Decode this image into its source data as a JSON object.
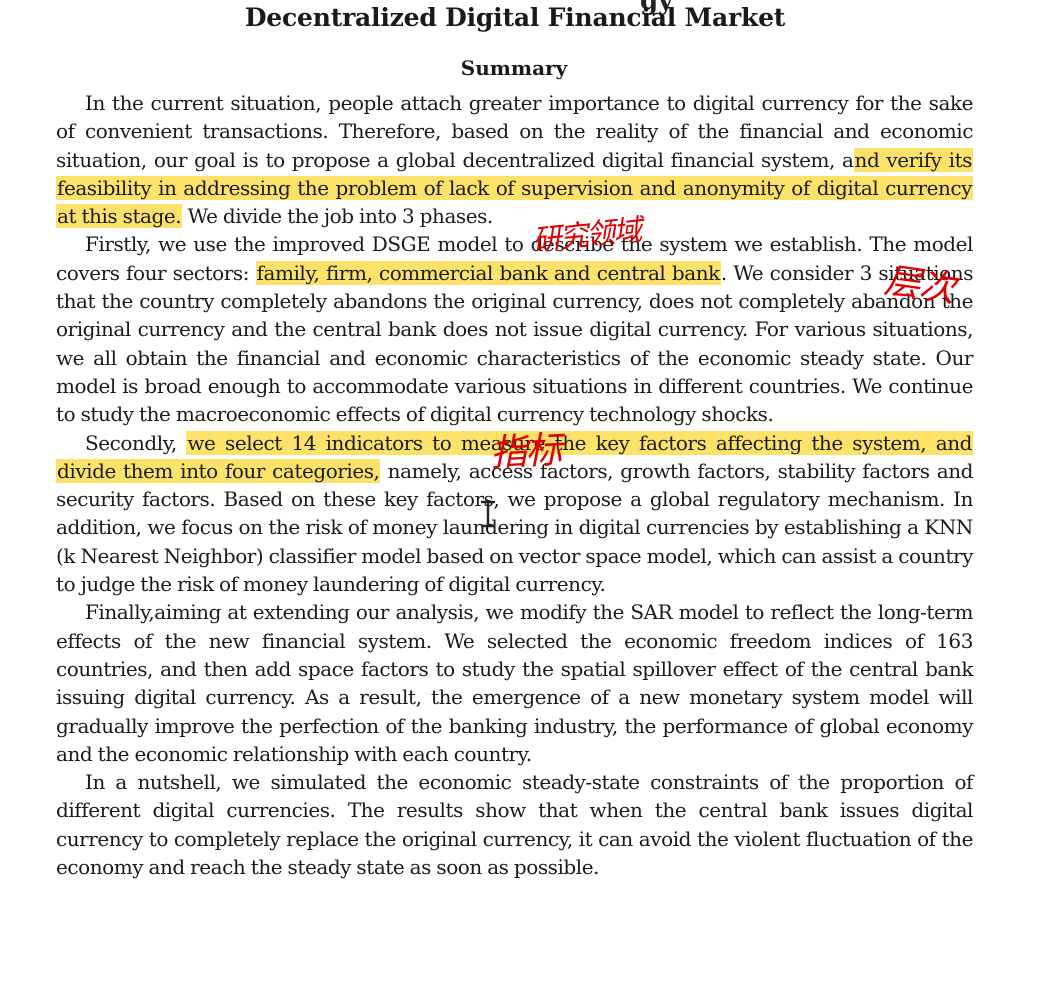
{
  "document": {
    "title_fragment_top": "gy",
    "title": "Decentralized Digital Financial Market",
    "section_heading": "Summary",
    "paragraphs": [
      [
        {
          "t": "In the current situation, people attach greater importance to digital currency for the sake of convenient transactions. Therefore, based on the reality of the financial and economic situation, our goal is to propose a global decentralized digital financial system, a"
        },
        {
          "t": "nd verify its feasibility in addressing the problem of lack of supervision and anonymity of digital currency at this stage.",
          "hl": true
        },
        {
          "t": " We divide the job into 3 phases."
        }
      ],
      [
        {
          "t": "Firstly, we use the improved DSGE model to describe the system we establish. The model covers four sectors: "
        },
        {
          "t": "family, firm, commercial bank and central bank",
          "hl": true
        },
        {
          "t": ". We consider 3 situations that the country completely abandons the original currency, does not completely abandon the original currency and the central bank does not issue digital currency. For various situations, we all obtain the financial and economic characteristics of the economic steady state. Our model is broad enough to accommodate various situations in different countries. We continue to study the macroeconomic effects of digital currency technology shocks."
        }
      ],
      [
        {
          "t": "Secondly, "
        },
        {
          "t": "we select 14 indicators to measure the key factors affecting the system, and divide them into four categories,",
          "hl": true
        },
        {
          "t": " namely, access factors, growth factors, stability factors and security factors. Based on these key factors, we propose a global regulatory mechanism. In addition, we focus on the risk of money laundering in digital currencies by establishing a KNN (k Nearest Neighbor) classifier model based on vector space model, which can assist a country to judge the risk of money laundering of digital currency."
        }
      ],
      [
        {
          "t": "Finally,aiming at extending our analysis, we modify the SAR model to reflect the long-term effects of the new financial system. We selected the economic freedom indices of 163 countries, and then add space factors to study the spatial spillover effect of the central bank issuing digital currency. As a result, the emergence of a new monetary system model will gradually improve the perfection of the banking industry, the performance of global economy and the economic relationship with each country."
        }
      ],
      [
        {
          "t": "In a nutshell, we simulated the economic steady-state constraints of the proportion of different digital currencies. The results show that when the central bank issues digital currency to completely replace the original currency, it can avoid the violent fluctuation of the economy and reach the steady state as soon as possible."
        }
      ]
    ]
  },
  "annotations": [
    {
      "text": "研究领域"
    },
    {
      "text": "层次"
    },
    {
      "text": "指标"
    }
  ],
  "cursor": {
    "icon": "text-ibeam-cursor-icon"
  },
  "colors": {
    "highlight": "#fde26a",
    "annotation_ink": "#e00000",
    "text": "#1a1a1a",
    "background": "#ffffff"
  }
}
